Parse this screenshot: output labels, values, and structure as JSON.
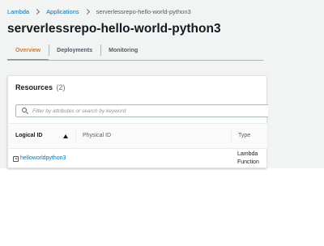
{
  "breadcrumb": {
    "items": [
      "Lambda",
      "Applications"
    ],
    "current": "serverlessrepo-hello-world-python3"
  },
  "page": {
    "title": "serverlessrepo-hello-world-python3"
  },
  "tabs": [
    {
      "label": "Overview",
      "active": true
    },
    {
      "label": "Deployments",
      "active": false
    },
    {
      "label": "Monitoring",
      "active": false
    }
  ],
  "resources": {
    "title": "Resources",
    "count": "(2)",
    "search_placeholder": "Filter by attributes or search by keyword",
    "columns": {
      "logical_id": "Logical ID",
      "physical_id": "Physical ID",
      "type": "Type"
    },
    "rows": [
      {
        "logical_id": "helloworldpython3",
        "physical_id": "",
        "type": "Lambda Function"
      }
    ]
  },
  "colors": {
    "accent": "#ec7211",
    "link": "#0073bb",
    "background": "#f2f3f3"
  },
  "icons": [
    "chevron-right-icon",
    "search-icon",
    "sort-ascending-icon",
    "expand-caret-icon"
  ]
}
